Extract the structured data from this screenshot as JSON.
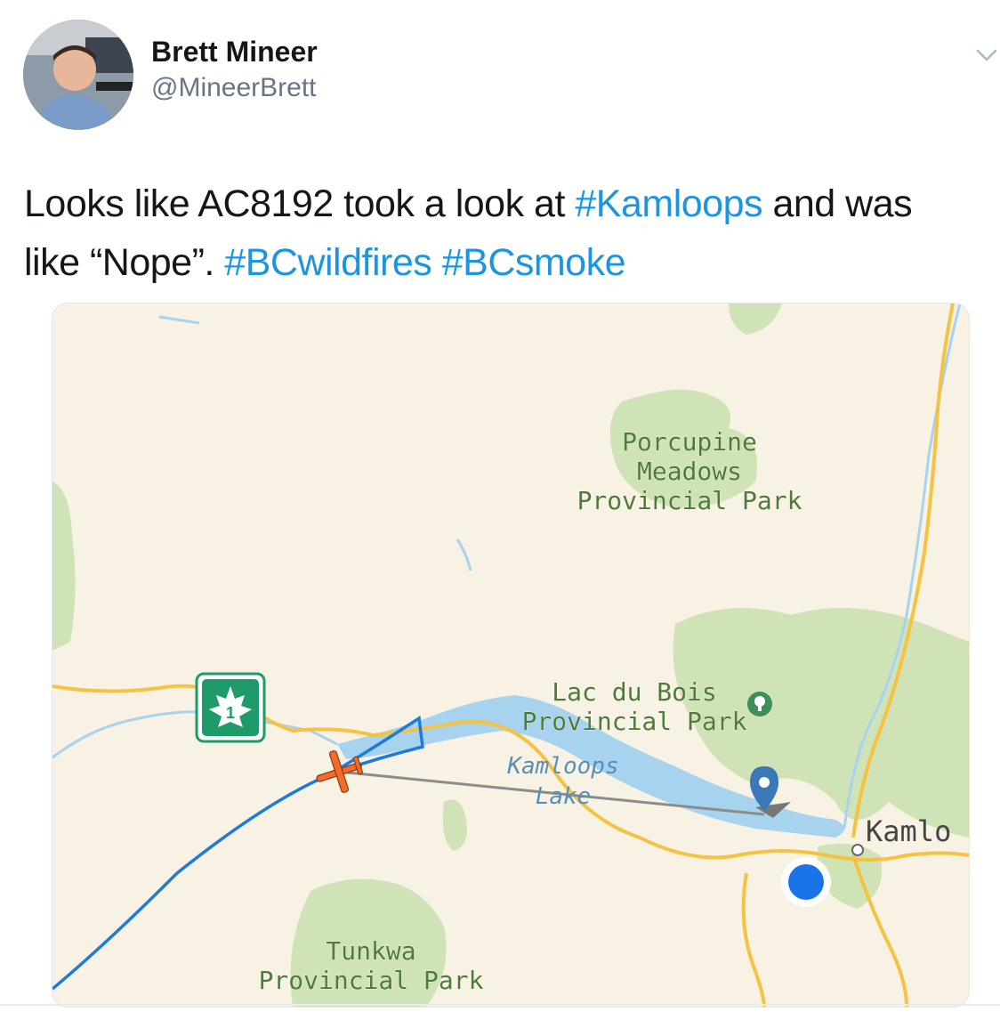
{
  "user": {
    "name": "Brett Mineer",
    "handle": "@MineerBrett"
  },
  "tweet": {
    "text_1": "Looks like AC8192 took a look at ",
    "tag_1": "#Kamloops",
    "text_2": " and was like “Nope”. ",
    "tag_2": "#BCwildfires",
    "text_3": " ",
    "tag_3": "#BCsmoke"
  },
  "map": {
    "labels": {
      "porcupine_1": "Porcupine",
      "porcupine_2": "Meadows",
      "porcupine_3": "Provincial Park",
      "lacdubois_1": "Lac du Bois",
      "lacdubois_2": "Provincial Park",
      "kamloops_lake_1": "Kamloops",
      "kamloops_lake_2": "Lake",
      "city": "Kamlo",
      "tunkwa_1": "Tunkwa",
      "tunkwa_2": "Provincial Park",
      "highway_number": "1"
    },
    "colors": {
      "land": "#f7f2e4",
      "park": "#cfe3b6",
      "water": "#a8d3ee",
      "road": "#f5c242",
      "flight_path": "#1f7ae0",
      "plane": "#f26b2a",
      "highway_sign": "#1f9a6a",
      "park_label": "#4d7a3a",
      "water_label": "#5a8fb8",
      "location_dot": "#1a73e8",
      "pin": "#3a78b8"
    },
    "icons": [
      "airplane-icon",
      "location-pin-icon",
      "current-location-icon",
      "highway-shield-icon",
      "park-tree-icon",
      "city-dot-icon"
    ]
  }
}
